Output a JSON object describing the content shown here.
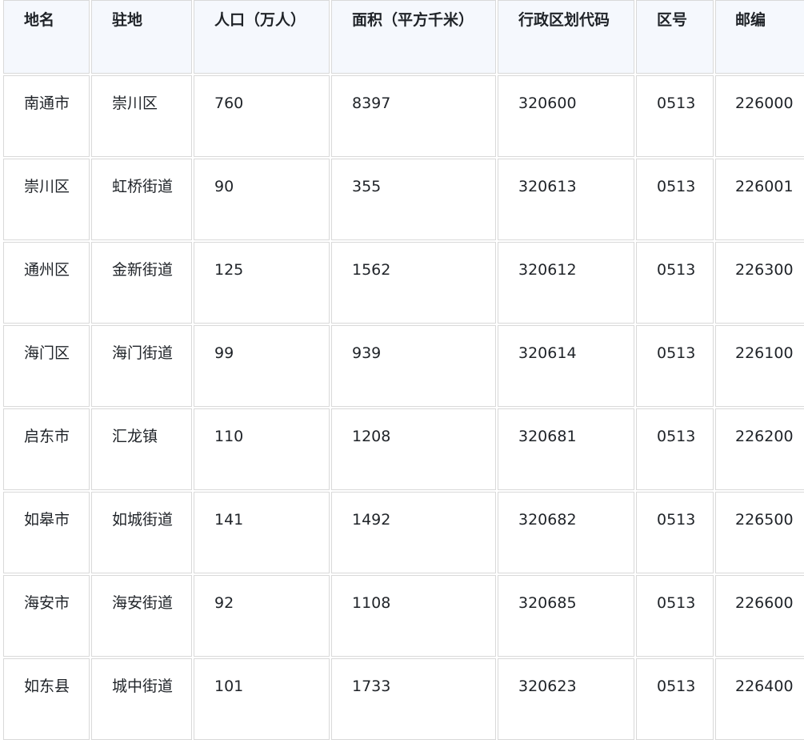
{
  "table": {
    "headers": [
      "地名",
      "驻地",
      "人口（万人）",
      "面积（平方千米）",
      "行政区划代码",
      "区号",
      "邮编"
    ],
    "rows": [
      [
        "南通市",
        "崇川区",
        "760",
        "8397",
        "320600",
        "0513",
        "226000"
      ],
      [
        "崇川区",
        "虹桥街道",
        "90",
        "355",
        "320613",
        "0513",
        "226001"
      ],
      [
        "通州区",
        "金新街道",
        "125",
        "1562",
        "320612",
        "0513",
        "226300"
      ],
      [
        "海门区",
        "海门街道",
        "99",
        "939",
        "320614",
        "0513",
        "226100"
      ],
      [
        "启东市",
        "汇龙镇",
        "110",
        "1208",
        "320681",
        "0513",
        "226200"
      ],
      [
        "如皋市",
        "如城街道",
        "141",
        "1492",
        "320682",
        "0513",
        "226500"
      ],
      [
        "海安市",
        "海安街道",
        "92",
        "1108",
        "320685",
        "0513",
        "226600"
      ],
      [
        "如东县",
        "城中街道",
        "101",
        "1733",
        "320623",
        "0513",
        "226400"
      ]
    ]
  }
}
